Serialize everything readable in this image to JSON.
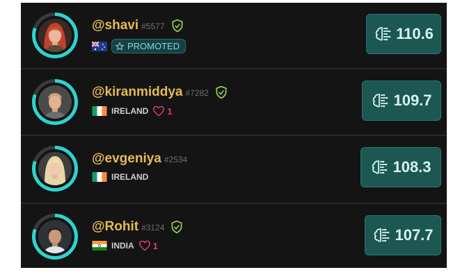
{
  "leaderboard": [
    {
      "username": "@shavi",
      "tag": "#5577",
      "country_flag": "australia-flag",
      "badge": "PROMOTED",
      "likes": null,
      "score": "110.6",
      "avatar": "red-haired-woman"
    },
    {
      "username": "@kiranmiddya",
      "tag": "#7282",
      "country_flag": "ireland-flag",
      "country": "IRELAND",
      "likes": "1",
      "score": "109.7",
      "avatar": "blond-man"
    },
    {
      "username": "@evgeniya",
      "tag": "#2534",
      "country_flag": "ireland-flag",
      "country": "IRELAND",
      "likes": null,
      "score": "108.3",
      "avatar": "blonde-woman"
    },
    {
      "username": "@Rohit",
      "tag": "#3124",
      "country_flag": "india-flag",
      "country": "INDIA",
      "likes": "1",
      "score": "107.7",
      "avatar": "dark-haired-man"
    }
  ],
  "colors": {
    "username": "#e6bb55",
    "accent": "#2ed3cf",
    "score_bg": "#1c5752",
    "heart": "#e23b7e",
    "verified": "#9ad44a"
  }
}
